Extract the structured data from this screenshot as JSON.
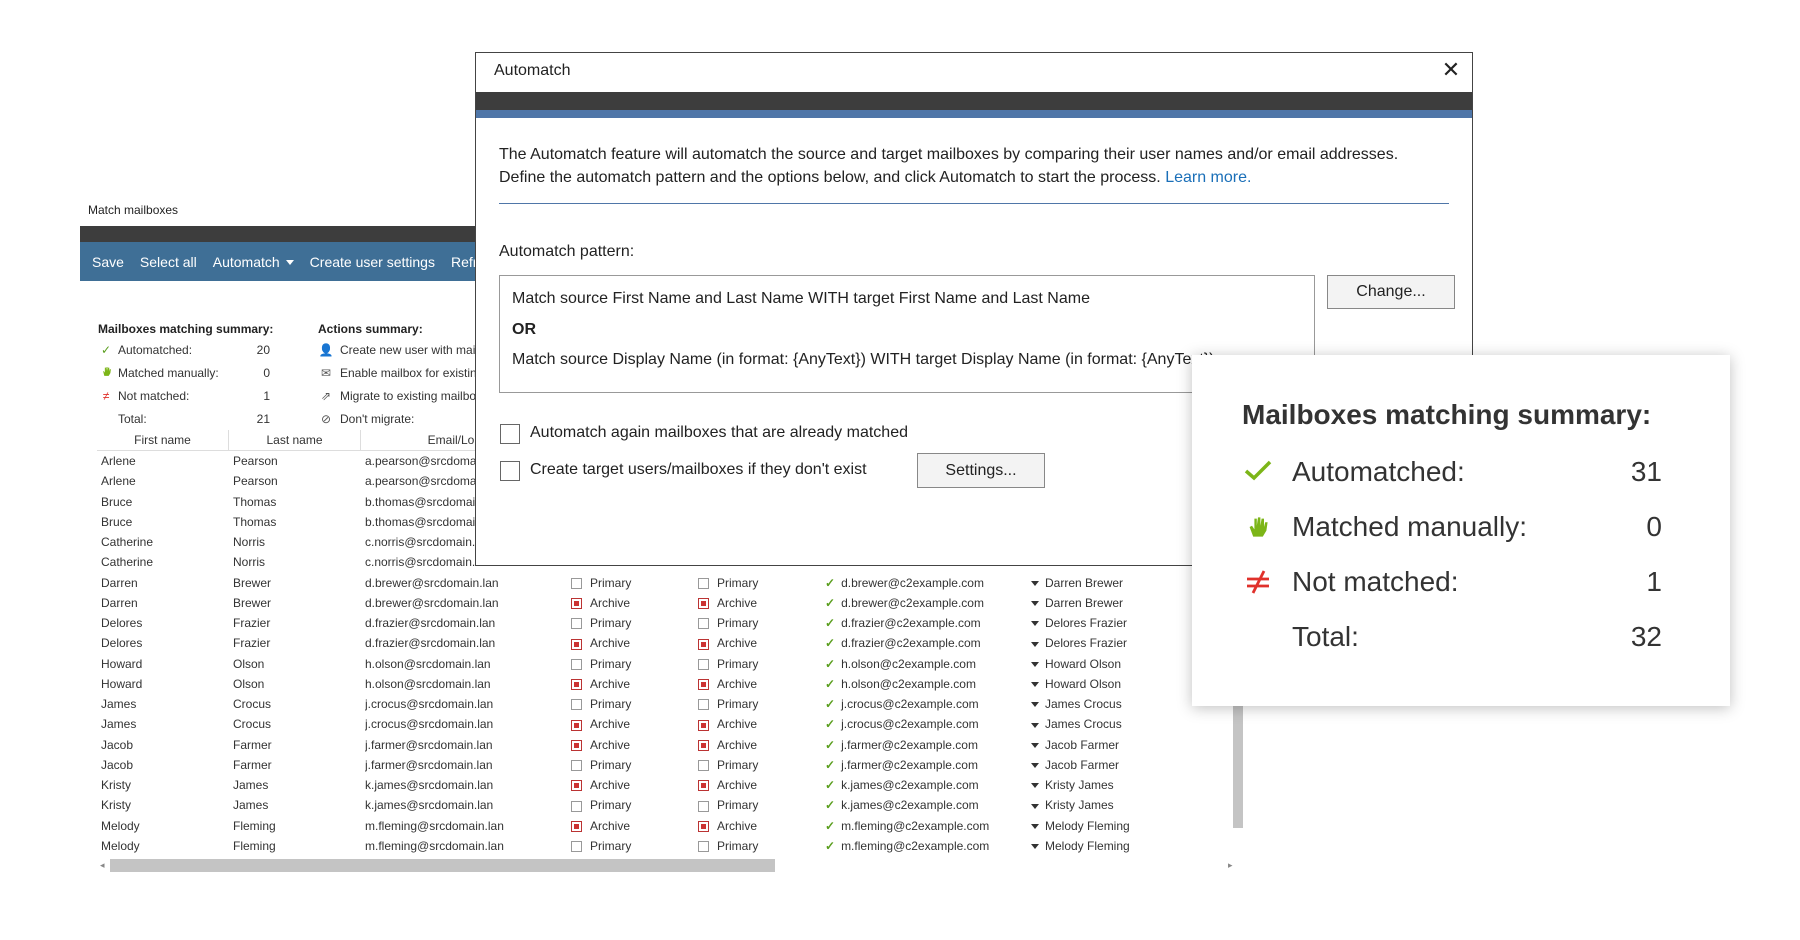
{
  "background_window": {
    "title": "Match mailboxes",
    "toolbar": [
      "Save",
      "Select all",
      "Automatch",
      "Create user settings",
      "Refre"
    ],
    "summary": {
      "heading": "Mailboxes matching summary:",
      "rows": [
        {
          "icon": "check-icon",
          "label": "Automatched:",
          "value": "20"
        },
        {
          "icon": "hand-icon",
          "label": "Matched manually:",
          "value": "0"
        },
        {
          "icon": "not-equal-icon",
          "label": "Not matched:",
          "value": "1"
        },
        {
          "icon": "",
          "label": "Total:",
          "value": "21"
        }
      ]
    },
    "actions": {
      "heading": "Actions summary:",
      "rows": [
        {
          "icon": "add-user-icon",
          "label": "Create new user with mail"
        },
        {
          "icon": "mail-icon",
          "label": "Enable mailbox for existing"
        },
        {
          "icon": "migrate-icon",
          "label": "Migrate to existing mailbo"
        },
        {
          "icon": "block-icon",
          "label": "Don't migrate:"
        }
      ]
    },
    "grid": {
      "columns": [
        "First name",
        "Last name",
        "Email/Lo"
      ],
      "rows": [
        {
          "first": "Arlene",
          "last": "Pearson",
          "email": "a.pearson@srcdoma"
        },
        {
          "first": "Arlene",
          "last": "Pearson",
          "email": "a.pearson@srcdoma"
        },
        {
          "first": "Bruce",
          "last": "Thomas",
          "email": "b.thomas@srcdomai"
        },
        {
          "first": "Bruce",
          "last": "Thomas",
          "email": "b.thomas@srcdomai"
        },
        {
          "first": "Catherine",
          "last": "Norris",
          "email": "c.norris@srcdomain."
        },
        {
          "first": "Catherine",
          "last": "Norris",
          "email": "c.norris@srcdomain."
        },
        {
          "first": "Darren",
          "last": "Brewer",
          "email": "d.brewer@srcdomain.lan",
          "src": "Primary",
          "tgt": "Primary",
          "temail": "d.brewer@c2example.com",
          "tname": "Darren Brewer"
        },
        {
          "first": "Darren",
          "last": "Brewer",
          "email": "d.brewer@srcdomain.lan",
          "src": "Archive",
          "tgt": "Archive",
          "temail": "d.brewer@c2example.com",
          "tname": "Darren Brewer"
        },
        {
          "first": "Delores",
          "last": "Frazier",
          "email": "d.frazier@srcdomain.lan",
          "src": "Primary",
          "tgt": "Primary",
          "temail": "d.frazier@c2example.com",
          "tname": "Delores Frazier"
        },
        {
          "first": "Delores",
          "last": "Frazier",
          "email": "d.frazier@srcdomain.lan",
          "src": "Archive",
          "tgt": "Archive",
          "temail": "d.frazier@c2example.com",
          "tname": "Delores Frazier"
        },
        {
          "first": "Howard",
          "last": "Olson",
          "email": "h.olson@srcdomain.lan",
          "src": "Primary",
          "tgt": "Primary",
          "temail": "h.olson@c2example.com",
          "tname": "Howard Olson"
        },
        {
          "first": "Howard",
          "last": "Olson",
          "email": "h.olson@srcdomain.lan",
          "src": "Archive",
          "tgt": "Archive",
          "temail": "h.olson@c2example.com",
          "tname": "Howard Olson"
        },
        {
          "first": "James",
          "last": "Crocus",
          "email": "j.crocus@srcdomain.lan",
          "src": "Primary",
          "tgt": "Primary",
          "temail": "j.crocus@c2example.com",
          "tname": "James Crocus"
        },
        {
          "first": "James",
          "last": "Crocus",
          "email": "j.crocus@srcdomain.lan",
          "src": "Archive",
          "tgt": "Archive",
          "temail": "j.crocus@c2example.com",
          "tname": "James Crocus"
        },
        {
          "first": "Jacob",
          "last": "Farmer",
          "email": "j.farmer@srcdomain.lan",
          "src": "Archive",
          "tgt": "Archive",
          "temail": "j.farmer@c2example.com",
          "tname": "Jacob Farmer"
        },
        {
          "first": "Jacob",
          "last": "Farmer",
          "email": "j.farmer@srcdomain.lan",
          "src": "Primary",
          "tgt": "Primary",
          "temail": "j.farmer@c2example.com",
          "tname": "Jacob Farmer"
        },
        {
          "first": "Kristy",
          "last": "James",
          "email": "k.james@srcdomain.lan",
          "src": "Archive",
          "tgt": "Archive",
          "temail": "k.james@c2example.com",
          "tname": "Kristy James"
        },
        {
          "first": "Kristy",
          "last": "James",
          "email": "k.james@srcdomain.lan",
          "src": "Primary",
          "tgt": "Primary",
          "temail": "k.james@c2example.com",
          "tname": "Kristy James"
        },
        {
          "first": "Melody",
          "last": "Fleming",
          "email": "m.fleming@srcdomain.lan",
          "src": "Archive",
          "tgt": "Archive",
          "temail": "m.fleming@c2example.com",
          "tname": "Melody Fleming"
        },
        {
          "first": "Melody",
          "last": "Fleming",
          "email": "m.fleming@srcdomain.lan",
          "src": "Primary",
          "tgt": "Primary",
          "temail": "m.fleming@c2example.com",
          "tname": "Melody Fleming"
        }
      ]
    }
  },
  "dialog": {
    "title": "Automatch",
    "close_icon": "close-icon",
    "description": "The Automatch feature will automatch the source and target mailboxes by comparing their user names and/or email addresses. Define the automatch pattern and the options below, and click Automatch to start the process.",
    "learn_more": "Learn more.",
    "pattern_label": "Automatch pattern:",
    "pattern_line1": "Match source First Name and Last Name WITH target First Name and Last Name",
    "pattern_or": "OR",
    "pattern_line2": "Match source Display Name (in format: {AnyText}) WITH target Display Name (in format: {AnyText})",
    "change_button": "Change...",
    "checkbox1_label": "Automatch again mailboxes that are already matched",
    "checkbox1_checked": false,
    "checkbox2_label": "Create target users/mailboxes if they don't exist",
    "checkbox2_checked": false,
    "settings_button": "Settings..."
  },
  "card": {
    "title": "Mailboxes matching summary:",
    "rows": [
      {
        "icon": "check-icon",
        "label": "Automatched:",
        "value": "31"
      },
      {
        "icon": "hand-icon",
        "label": "Matched manually:",
        "value": "0"
      },
      {
        "icon": "not-equal-icon",
        "label": "Not matched:",
        "value": "1"
      },
      {
        "icon": "",
        "label": "Total:",
        "value": "32"
      }
    ]
  },
  "colors": {
    "toolbar": "#3f6f96",
    "accent_blue": "#4f76a8",
    "check_green": "#5a9e1e",
    "hand_green": "#7cb518",
    "not_matched_red": "#e0312b",
    "link": "#1a6fb8"
  }
}
